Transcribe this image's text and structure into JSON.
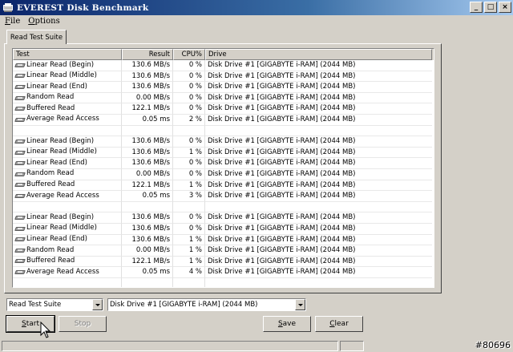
{
  "window": {
    "title": "EVEREST Disk Benchmark",
    "buttons": {
      "minimize": "_",
      "maximize": "□",
      "close": "×"
    }
  },
  "menu": [
    {
      "label": "File",
      "accel": "F",
      "rest": "ile"
    },
    {
      "label": "Options",
      "accel": "O",
      "rest": "ptions"
    }
  ],
  "tab": {
    "label": "Read Test Suite"
  },
  "table": {
    "headers": {
      "test": "Test",
      "result": "Result",
      "cpu": "CPU%",
      "drive": "Drive"
    },
    "rows": [
      {
        "test": "Linear Read (Begin)",
        "result": "130.6 MB/s",
        "cpu": "0 %",
        "drive": "Disk Drive #1  [GIGABYTE i-RAM]  (2044 MB)"
      },
      {
        "test": "Linear Read (Middle)",
        "result": "130.6 MB/s",
        "cpu": "0 %",
        "drive": "Disk Drive #1  [GIGABYTE i-RAM]  (2044 MB)"
      },
      {
        "test": "Linear Read (End)",
        "result": "130.6 MB/s",
        "cpu": "0 %",
        "drive": "Disk Drive #1  [GIGABYTE i-RAM]  (2044 MB)"
      },
      {
        "test": "Random Read",
        "result": "0.00 MB/s",
        "cpu": "0 %",
        "drive": "Disk Drive #1  [GIGABYTE i-RAM]  (2044 MB)"
      },
      {
        "test": "Buffered Read",
        "result": "122.1 MB/s",
        "cpu": "0 %",
        "drive": "Disk Drive #1  [GIGABYTE i-RAM]  (2044 MB)"
      },
      {
        "test": "Average Read Access",
        "result": "0.05 ms",
        "cpu": "2 %",
        "drive": "Disk Drive #1  [GIGABYTE i-RAM]  (2044 MB)"
      },
      {
        "test": "",
        "result": "",
        "cpu": "",
        "drive": ""
      },
      {
        "test": "Linear Read (Begin)",
        "result": "130.6 MB/s",
        "cpu": "0 %",
        "drive": "Disk Drive #1  [GIGABYTE i-RAM]  (2044 MB)"
      },
      {
        "test": "Linear Read (Middle)",
        "result": "130.6 MB/s",
        "cpu": "1 %",
        "drive": "Disk Drive #1  [GIGABYTE i-RAM]  (2044 MB)"
      },
      {
        "test": "Linear Read (End)",
        "result": "130.6 MB/s",
        "cpu": "0 %",
        "drive": "Disk Drive #1  [GIGABYTE i-RAM]  (2044 MB)"
      },
      {
        "test": "Random Read",
        "result": "0.00 MB/s",
        "cpu": "0 %",
        "drive": "Disk Drive #1  [GIGABYTE i-RAM]  (2044 MB)"
      },
      {
        "test": "Buffered Read",
        "result": "122.1 MB/s",
        "cpu": "1 %",
        "drive": "Disk Drive #1  [GIGABYTE i-RAM]  (2044 MB)"
      },
      {
        "test": "Average Read Access",
        "result": "0.05 ms",
        "cpu": "3 %",
        "drive": "Disk Drive #1  [GIGABYTE i-RAM]  (2044 MB)"
      },
      {
        "test": "",
        "result": "",
        "cpu": "",
        "drive": ""
      },
      {
        "test": "Linear Read (Begin)",
        "result": "130.6 MB/s",
        "cpu": "0 %",
        "drive": "Disk Drive #1  [GIGABYTE i-RAM]  (2044 MB)"
      },
      {
        "test": "Linear Read (Middle)",
        "result": "130.6 MB/s",
        "cpu": "0 %",
        "drive": "Disk Drive #1  [GIGABYTE i-RAM]  (2044 MB)"
      },
      {
        "test": "Linear Read (End)",
        "result": "130.6 MB/s",
        "cpu": "1 %",
        "drive": "Disk Drive #1  [GIGABYTE i-RAM]  (2044 MB)"
      },
      {
        "test": "Random Read",
        "result": "0.00 MB/s",
        "cpu": "1 %",
        "drive": "Disk Drive #1  [GIGABYTE i-RAM]  (2044 MB)"
      },
      {
        "test": "Buffered Read",
        "result": "122.1 MB/s",
        "cpu": "1 %",
        "drive": "Disk Drive #1  [GIGABYTE i-RAM]  (2044 MB)"
      },
      {
        "test": "Average Read Access",
        "result": "0.05 ms",
        "cpu": "4 %",
        "drive": "Disk Drive #1  [GIGABYTE i-RAM]  (2044 MB)"
      },
      {
        "test": "",
        "result": "",
        "cpu": "",
        "drive": ""
      }
    ]
  },
  "controls": {
    "suite_select": "Read Test Suite",
    "drive_select": "Disk Drive #1  [GIGABYTE i-RAM]  (2044 MB)",
    "start_label": "Start",
    "start_accel": "S",
    "start_rest": "tart",
    "stop_label": "Stop",
    "save_label": "Save",
    "save_accel": "S",
    "save_rest": "ave",
    "clear_label": "Clear",
    "clear_accel": "C",
    "clear_rest": "lear"
  },
  "watermark": "#80696",
  "icons": {
    "row_icon": "disk-drive-icon",
    "app_icon": "everest-app-icon"
  }
}
